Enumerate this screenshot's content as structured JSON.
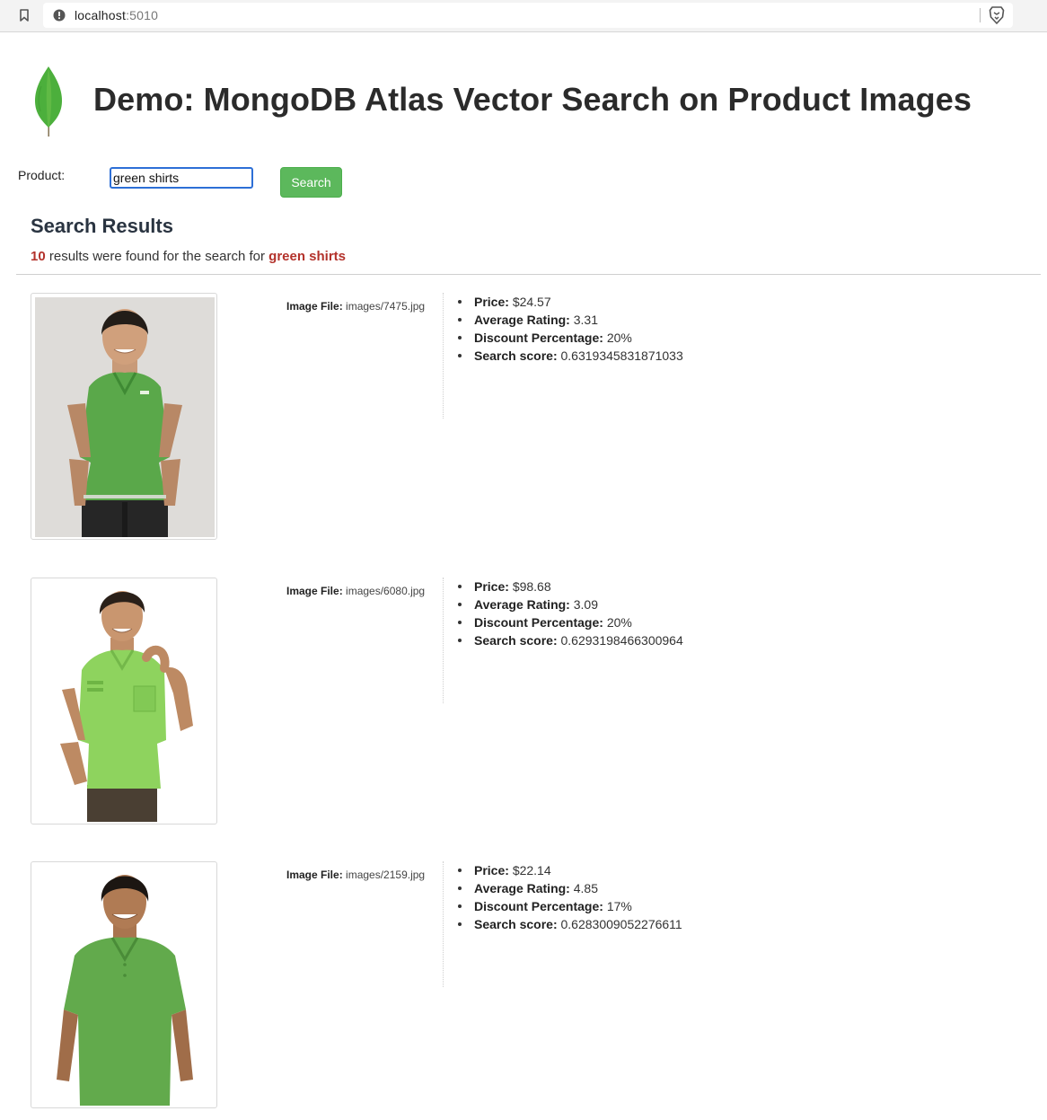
{
  "browser": {
    "url_host": "localhost",
    "url_port": ":5010"
  },
  "header": {
    "title": "Demo: MongoDB Atlas Vector Search on Product Images"
  },
  "search_form": {
    "label": "Product:",
    "value": "green shirts",
    "button_label": "Search"
  },
  "results": {
    "heading": "Search Results",
    "count": "10",
    "summary_text": "results were found for the search for",
    "query": "green shirts",
    "image_file_label": "Image File:",
    "price_label": "Price:",
    "rating_label": "Average Rating:",
    "discount_label": "Discount Percentage:",
    "score_label": "Search score:",
    "items": [
      {
        "image_file": "images/7475.jpg",
        "price": "$24.57",
        "rating": "3.31",
        "discount": "20%",
        "score": "0.6319345831871033"
      },
      {
        "image_file": "images/6080.jpg",
        "price": "$98.68",
        "rating": "3.09",
        "discount": "20%",
        "score": "0.6293198466300964"
      },
      {
        "image_file": "images/2159.jpg",
        "price": "$22.14",
        "rating": "4.85",
        "discount": "17%",
        "score": "0.6283009052276611"
      }
    ]
  },
  "colors": {
    "button_green": "#5cb85c",
    "highlight_red": "#b3322b",
    "leaf_green": "#4caf3c",
    "shirt_1": "#5aa84a",
    "shirt_2": "#8ed35e",
    "shirt_3": "#62aa4c"
  },
  "icons": {
    "bookmark": "bookmark-icon",
    "site_info": "info-icon",
    "shield": "brave-lion-icon",
    "logo": "mongodb-leaf-logo"
  }
}
